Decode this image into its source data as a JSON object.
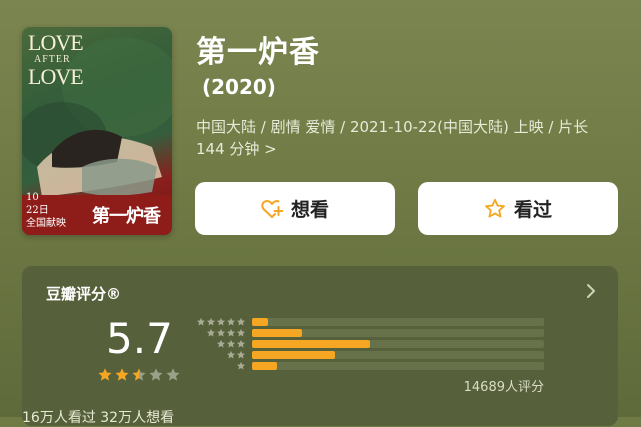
{
  "movie": {
    "title": "第一炉香",
    "year": "(2020)",
    "meta": "中国大陆 / 剧情 爱情 / 2021-10-22(中国大陆) 上映 / 片长144 分钟 >"
  },
  "poster": {
    "title_line1": "LOVE",
    "title_line2": "AFTER",
    "title_line3": "LOVE",
    "cn_title": "第一炉香",
    "date_line1": "10",
    "date_line2": "22日",
    "date_line3": "全国献映"
  },
  "actions": {
    "want_label": "想看",
    "seen_label": "看过"
  },
  "rating": {
    "title": "豆瓣评分®",
    "score": "5.7",
    "stars_filled": 2.5,
    "distribution": [
      {
        "stars": 5,
        "percent": 5.5
      },
      {
        "stars": 4,
        "percent": 17
      },
      {
        "stars": 3,
        "percent": 40.5
      },
      {
        "stars": 2,
        "percent": 28.5
      },
      {
        "stars": 1,
        "percent": 8.5
      }
    ],
    "count_text": "14689人评分"
  },
  "footer": {
    "text": "16万人看过  32万人想看"
  },
  "colors": {
    "accent": "#f5a623",
    "background": "#6f7a45",
    "card": "#56603a"
  }
}
